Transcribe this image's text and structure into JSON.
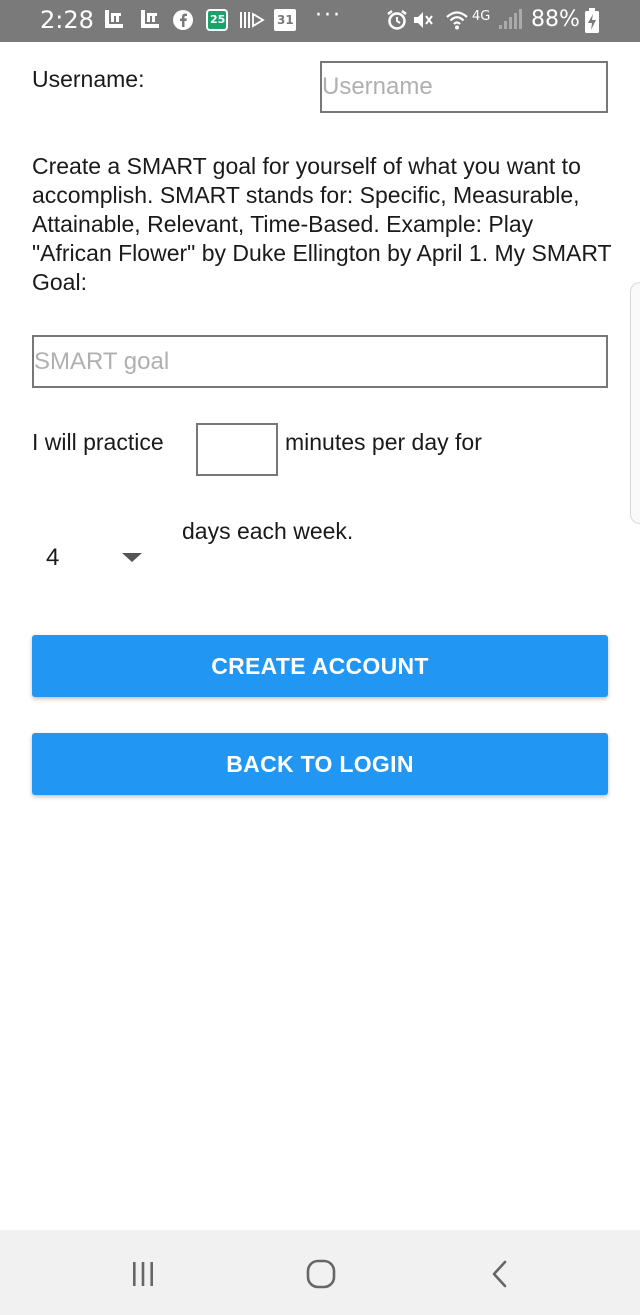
{
  "status_bar": {
    "time": "2:28",
    "calendar_badge": "25",
    "calendar_date": "31",
    "overflow": "···",
    "network": "4G",
    "battery": "88%",
    "icons": [
      "gallery-icon",
      "gallery-icon",
      "facebook-icon",
      "calendar-icon",
      "media-icon",
      "calendar-icon",
      "alarm-icon",
      "mute-icon",
      "wifi-icon",
      "signal-icon",
      "battery-charging-icon"
    ]
  },
  "form": {
    "username_label": "Username:",
    "username_placeholder": "Username",
    "username_value": "",
    "description": "Create a SMART goal for yourself of what you want to accomplish. SMART stands for: Specific, Measurable, Attainable, Relevant, Time-Based. Example: Play \"African Flower\" by Duke Ellington by April 1. My SMART Goal:",
    "goal_placeholder": "SMART goal",
    "goal_value": "",
    "practice_prefix": "I will practice",
    "minutes_value": "",
    "practice_suffix": "minutes per day for",
    "days_selected": "4",
    "days_suffix": "days each week."
  },
  "buttons": {
    "create_account": "CREATE ACCOUNT",
    "back_to_login": "BACK TO LOGIN"
  },
  "colors": {
    "status_bar_bg": "#7a7a7a",
    "button_bg": "#2196f3",
    "button_text": "#ffffff",
    "nav_bar_bg": "#f1f1f1"
  },
  "nav_bar": {
    "icons": [
      "recent-apps-icon",
      "home-icon",
      "back-icon"
    ]
  }
}
